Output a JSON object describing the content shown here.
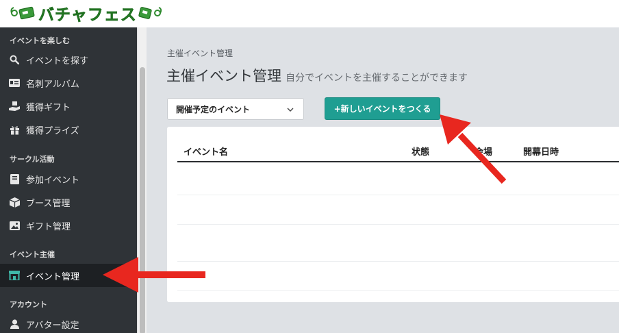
{
  "brand": {
    "name": "バチャフェス",
    "colors": {
      "green": "#2e8a2e",
      "accent": "#1f9e92",
      "sidebar": "#2f3337",
      "annotation": "#e8271f"
    }
  },
  "sidebar": {
    "sections": [
      {
        "title": "イベントを楽しむ",
        "items": [
          {
            "label": "イベントを探す",
            "icon": "search-icon"
          },
          {
            "label": "名刺アルバム",
            "icon": "id-card-icon"
          },
          {
            "label": "獲得ギフト",
            "icon": "gift-hand-icon"
          },
          {
            "label": "獲得プライズ",
            "icon": "gift-icon"
          }
        ]
      },
      {
        "title": "サークル活動",
        "items": [
          {
            "label": "参加イベント",
            "icon": "book-icon"
          },
          {
            "label": "ブース管理",
            "icon": "box-icon"
          },
          {
            "label": "ギフト管理",
            "icon": "image-icon"
          }
        ]
      },
      {
        "title": "イベント主催",
        "items": [
          {
            "label": "イベント管理",
            "icon": "store-icon",
            "active": true
          }
        ]
      },
      {
        "title": "アカウント",
        "items": [
          {
            "label": "アバター設定",
            "icon": "user-icon"
          }
        ]
      }
    ]
  },
  "main": {
    "breadcrumb": "主催イベント管理",
    "title": "主催イベント管理",
    "subtitle": "自分でイベントを主催することができます",
    "filter": {
      "selected": "開催予定のイベント"
    },
    "new_button": "+新しいイベントをつくる",
    "table": {
      "columns": [
        "イベント名",
        "状態",
        "会場",
        "開幕日時"
      ],
      "rows": []
    }
  }
}
